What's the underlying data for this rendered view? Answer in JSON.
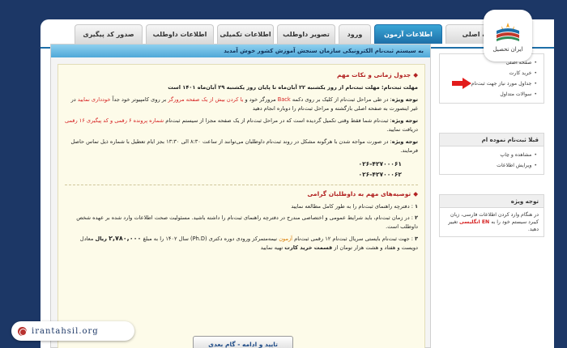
{
  "nav": {
    "tabs": [
      {
        "label": "صدور کد پیگیری",
        "active": false
      },
      {
        "label": "اطلاعات داوطلب",
        "active": false
      },
      {
        "label": "اطلاعات تکمیلی",
        "active": false
      },
      {
        "label": "تصویر داوطلب",
        "active": false
      },
      {
        "label": "ورود",
        "active": false
      },
      {
        "label": "اطلاعات آزمون",
        "active": true
      },
      {
        "label": "صفحه اصلی",
        "active": false
      }
    ]
  },
  "banner": "به سیستم ثبت‌نام الکترونیکی سازمان سنجش آموزش کشور خوش آمدید",
  "content": {
    "title": "جدول زمانی و نکات مهم",
    "p1": "مهلت ثبت‌نام: مهلت ثبت‌نام از روز یکشنبه ۲۲ آبان‌ماه تا پایان روز یکشنبه ۲۹ آبان‌ماه ۱۴۰۱ است",
    "p2_label": "توجه ویژه",
    "p2_a": ": در طی مراحل ثبت‌نام از کلیک بر روی دکمه",
    "p2_back": "Back",
    "p2_b": "مرورگر خود و",
    "p2_red": "یا کردن بیش از یک صفحه مرورگر",
    "p2_c": "بر روی کامپیوتر خود جداً",
    "p2_d": "خودداری نمایید",
    "p2_e": "در غیر اینصورت به صفحه اصلی بازگشته و مراحل ثبت‌نام را دوباره انجام دهید",
    "p3_label": "توجه ویژه",
    "p3_a": ": ثبت‌نام شما فقط وقتی تکمیل گردیده است که در مراحل ثبت‌نام از یک صفحه مجزا از سیستم ثبت‌نام",
    "p3_red": "شماره پرونده ۶ رقمی و کد پیگیری ۱۶ رقمی",
    "p3_b": "دریافت نمایید.",
    "p4_label": "توجه ویژه",
    "p4_a": ": در صورت مواجه شدن با هرگونه مشکل در روند ثبت‌نام داوطلبان می‌توانند از ساعت ۸:۳۰ الی ۱۳:۳۰ بجز ایام تعطیل با شماره",
    "p4_b": "ذیل تماس حاصل فرمایند.",
    "phone1": "۰۲۶-۴۲۷۰۰۰۶۱",
    "phone2": "۰۲۶-۴۲۷۰۰۰۶۲",
    "title2": "توصیه‌های مهم به داوطلبان گرامی",
    "n1_num": "۱",
    "n1": ": دفترچه راهنمای ثبت‌نام را به طور کامل مطالعه نمایید",
    "n2_num": "۲",
    "n2": ": در زمان ثبت‌نام، باید شرایط عمومی و اختصاصی مندرج در دفترچه راهنمای ثبت‌نام را داشته باشید. مسئولیت صحت اطلاعات وارد شده بر عهده شخص داوطلب است.",
    "n3_num": "۳",
    "n3_a": ": جهت ثبت‌نام بایستی سریال ثبت‌نام ۱۲ رقمی ثبت‌نام",
    "n3_orange": "آزمون",
    "n3_b": "نیمه‌متمرکز ورودی دوره دکتری (Ph.D) سال ۱۴۰۲ را به مبلغ",
    "n3_amount": "۲,۷۸۰,۰۰۰",
    "n3_c": "ریال",
    "n3_d": "معادل دویست و هفتاد و هشت هزار تومان از",
    "n3_bold": "قسمت خرید کارت",
    "n3_e": "تهیه نمایید",
    "next_button": "تایید و ادامه - گام بعدی"
  },
  "sidebar": {
    "menu": [
      "صفحه اصلی",
      "خرید کارت",
      "جداول مورد نیاز جهت ثبت‌نام",
      "سوالات متداول"
    ],
    "registered_title": "قبلا ثبت‌نام نموده ام",
    "registered_items": [
      "مشاهده و چاپ",
      "ویرایش اطلاعات"
    ],
    "tip_title": "توجه ویژه",
    "tip_a": "در هنگام وارد کردن اطلاعات فارسی، زبان کیبرد سیستم خود را به",
    "tip_en": "EN انگلیسی",
    "tip_b": "تغییر دهید."
  },
  "logo": {
    "text": "ایران تحصیل"
  },
  "footer": {
    "site": "irantahsil.org"
  },
  "colors": {
    "accent": "#1d6fa8",
    "red": "#d62020",
    "nav_bg": "#1c3766"
  }
}
